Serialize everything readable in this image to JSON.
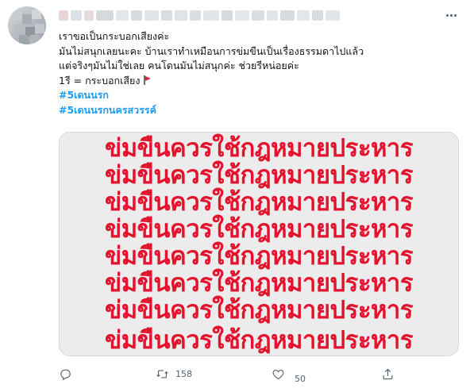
{
  "tweet": {
    "lines": [
      "เราขอเป็นกระบอกเสียงค่ะ",
      "มันไม่สนุกเลยนะคะ บ้านเราทำเหมือนการข่มขืนเป็นเรื่องธรรมดาไปแล้ว",
      "แต่จริงๆมันไม่ใช่เลย คนโดนมันไม่สนุกค่ะ  ช่วยรีหน่อยค่ะ",
      "1รี =  กระบอกเสียง"
    ],
    "hashtags": [
      "#5เดนนรก",
      "#5เดนนรกนครสวรรค์"
    ],
    "flag_icon": "red-flag-icon"
  },
  "media": {
    "text_line": "ข่มขืนควรใช้กฎหมายประหาร",
    "text_color": "#e3122d",
    "background": "#ececec"
  },
  "actions": {
    "reply_count": "",
    "retweet_count": "158",
    "like_count": "50",
    "share_count": ""
  }
}
